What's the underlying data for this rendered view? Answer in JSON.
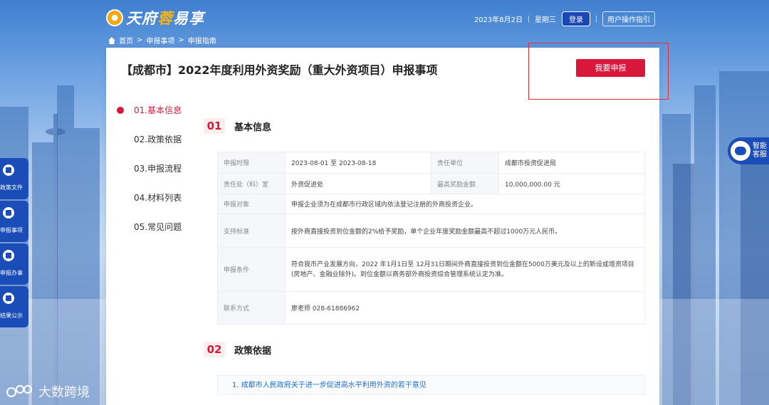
{
  "header": {
    "logo_text_a": "天府",
    "logo_text_b": "蓉",
    "logo_text_c": "易享",
    "date": "2023年8月2日",
    "weekday": "星期三",
    "login_label": "登录",
    "guide_label": "用户操作指引"
  },
  "breadcrumb": [
    "首页",
    "申报事项",
    "申报指南"
  ],
  "page": {
    "title": "【成都市】2022年度利用外资奖励（重大外资项目）申报事项",
    "apply_button": "我要申报"
  },
  "sidenav": [
    "01.基本信息",
    "02.政策依据",
    "03.申报流程",
    "04.材料列表",
    "05.常见问题"
  ],
  "sections": {
    "s1_num": "01",
    "s1_title": "基本信息",
    "s2_num": "02",
    "s2_title": "政策依据"
  },
  "info": {
    "period_label": "申报时限",
    "period_value": "2023-08-01 至 2023-08-18",
    "unit_label": "责任单位",
    "unit_value": "成都市投资促进局",
    "dept_label": "责任处（科）室",
    "dept_value": "外资促进处",
    "max_label": "最高奖励金额",
    "max_value": "10,000,000.00 元",
    "target_label": "申报对象",
    "target_value": "申报企业须为在成都市行政区域内依法登记注册的外商投资企业。",
    "standard_label": "支持标准",
    "standard_value": "按外商直接投资到位金额的2%给予奖励，单个企业年度奖励金额最高不超过1000万元人民币。",
    "cond_label": "申报条件",
    "cond_value": "符合我市产业发展方向，2022 年1月1日至 12月31日期间外商直接投资到位金额在5000万美元及以上的新设或增资项目(房地产、金融业除外)。到位金额以商务部外商投资综合管理系统认定为准。",
    "contact_label": "联系方式",
    "contact_value": "廖老师 028-61886962"
  },
  "policy": {
    "num": "1.",
    "link": "成都市人民政府关于进一步促进高水平利用外资的若干意见"
  },
  "float_menu": [
    "政策文件",
    "申报事项",
    "申报办事",
    "结果公示"
  ],
  "service": [
    "智能",
    "客服"
  ],
  "watermark": "大数跨境",
  "colors": {
    "primary_red": "#d9173a",
    "primary_blue": "#1a4db8",
    "link_blue": "#1a6fd6"
  }
}
